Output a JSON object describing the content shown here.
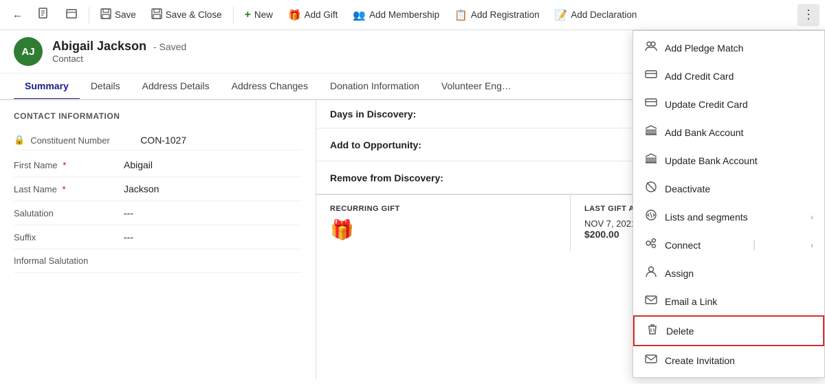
{
  "toolbar": {
    "back_label": "←",
    "document_icon": "📄",
    "tab_icon": "⬜",
    "save_label": "Save",
    "save_close_label": "Save & Close",
    "new_label": "New",
    "add_gift_label": "Add Gift",
    "add_membership_label": "Add Membership",
    "add_registration_label": "Add Registration",
    "add_declaration_label": "Add Declaration",
    "more_icon": "⋮"
  },
  "contact": {
    "initials": "AJ",
    "name": "Abigail Jackson",
    "saved_label": "- Saved",
    "type": "Contact"
  },
  "tabs": [
    {
      "label": "Summary",
      "active": true
    },
    {
      "label": "Details",
      "active": false
    },
    {
      "label": "Address Details",
      "active": false
    },
    {
      "label": "Address Changes",
      "active": false
    },
    {
      "label": "Donation Information",
      "active": false
    },
    {
      "label": "Volunteer Eng…",
      "active": false
    }
  ],
  "contact_info": {
    "section_title": "CONTACT INFORMATION",
    "constituent_number_label": "Constituent Number",
    "constituent_number_value": "CON-1027",
    "fields": [
      {
        "label": "First Name",
        "required": true,
        "value": "Abigail"
      },
      {
        "label": "Last Name",
        "required": true,
        "value": "Jackson"
      },
      {
        "label": "Salutation",
        "required": false,
        "value": "---"
      },
      {
        "label": "Suffix",
        "required": false,
        "value": "---"
      },
      {
        "label": "Informal Salutation",
        "required": false,
        "value": ""
      }
    ]
  },
  "discovery": {
    "days_label": "Days in Discovery:",
    "opportunity_label": "Add to Opportunity:",
    "remove_label": "Remove from Discovery:"
  },
  "gifts": {
    "recurring_title": "RECURRING GIFT",
    "last_gift_title": "LAST GIFT AMOUN…",
    "last_gift_date": "NOV 7, 2021",
    "last_gift_amount": "$200.00"
  },
  "dropdown_menu": {
    "items": [
      {
        "icon": "👥",
        "label": "Add Pledge Match",
        "has_arrow": false,
        "highlighted": false
      },
      {
        "icon": "💳",
        "label": "Add Credit Card",
        "has_arrow": false,
        "highlighted": false
      },
      {
        "icon": "💳",
        "label": "Update Credit Card",
        "has_arrow": false,
        "highlighted": false
      },
      {
        "icon": "🏦",
        "label": "Add Bank Account",
        "has_arrow": false,
        "highlighted": false
      },
      {
        "icon": "🏦",
        "label": "Update Bank Account",
        "has_arrow": false,
        "highlighted": false
      },
      {
        "icon": "🚫",
        "label": "Deactivate",
        "has_arrow": false,
        "highlighted": false
      },
      {
        "icon": "⚙️",
        "label": "Lists and segments",
        "has_arrow": true,
        "highlighted": false
      },
      {
        "icon": "👥",
        "label": "Connect",
        "has_arrow": true,
        "highlighted": false,
        "has_separator": true
      },
      {
        "icon": "👤",
        "label": "Assign",
        "has_arrow": false,
        "highlighted": false
      },
      {
        "icon": "✉️",
        "label": "Email a Link",
        "has_arrow": false,
        "highlighted": false
      },
      {
        "icon": "🗑️",
        "label": "Delete",
        "has_arrow": false,
        "highlighted": true
      },
      {
        "icon": "✉️",
        "label": "Create Invitation",
        "has_arrow": false,
        "highlighted": false
      }
    ]
  }
}
